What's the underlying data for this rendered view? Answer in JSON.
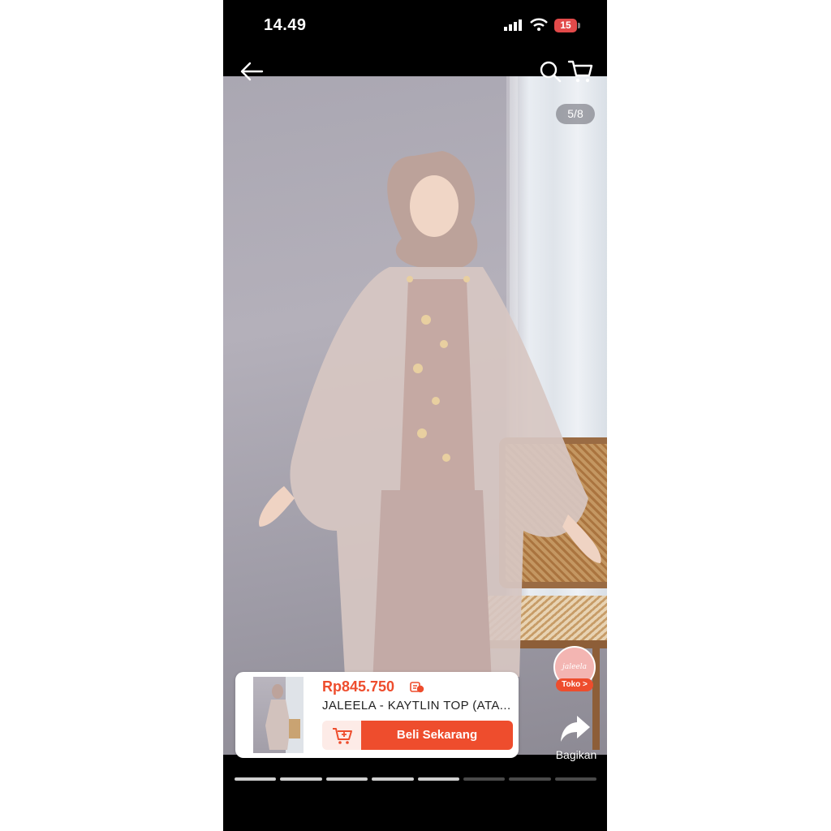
{
  "status_bar": {
    "time": "14.49",
    "battery": "15"
  },
  "gallery": {
    "page_indicator": "5/8",
    "current_index": 5,
    "total": 8
  },
  "shop": {
    "badge_text": "jaleela",
    "store_link": "Toko >"
  },
  "share": {
    "label": "Bagikan"
  },
  "product": {
    "price": "Rp845.750",
    "name": "JALEELA - KAYTLIN TOP (ATA...",
    "buy_label": "Beli Sekarang"
  },
  "colors": {
    "accent": "#ee4d2d",
    "progress_active": "#cfcfcf",
    "progress_inactive": "#4a4a4a"
  },
  "icons": [
    "back-arrow-icon",
    "search-icon",
    "cart-icon",
    "share-arrow-icon",
    "add-to-cart-icon",
    "coin-icon"
  ]
}
